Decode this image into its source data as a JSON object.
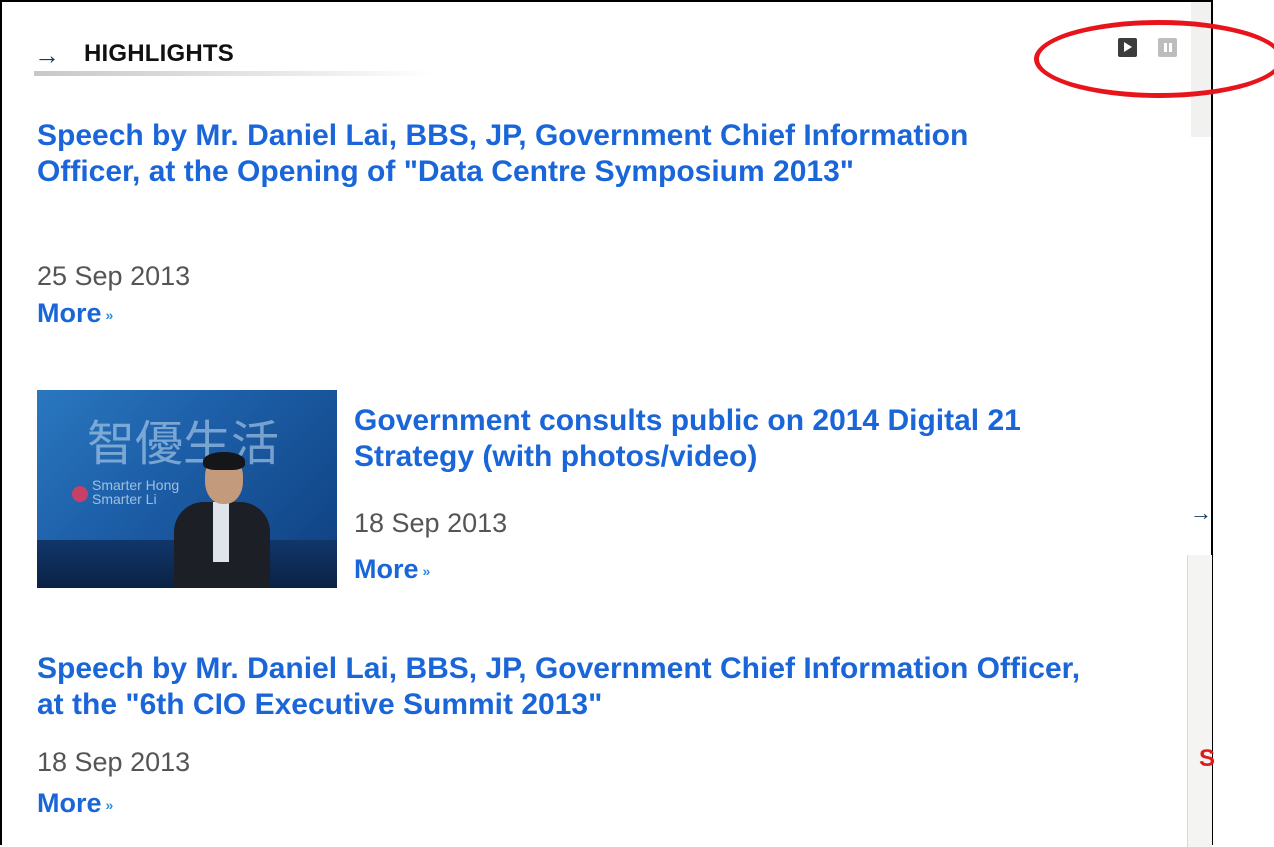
{
  "section": {
    "title": "HIGHLIGHTS",
    "arrow_icon": "right-arrow-icon"
  },
  "controls": {
    "play_icon": "play-icon",
    "pause_icon": "pause-icon"
  },
  "items": [
    {
      "headline": "Speech by Mr. Daniel Lai, BBS, JP, Government Chief Information Officer, at the Opening of \"Data Centre Symposium 2013\"",
      "date": "25 Sep 2013",
      "more": "More"
    },
    {
      "headline": "Government consults public on 2014 Digital 21 Strategy (with photos/video)",
      "date": "18 Sep 2013",
      "more": "More",
      "thumbnail": {
        "chinese_text": "智優生活",
        "english_lines": [
          "Smarter Hong",
          "Smarter Li"
        ]
      }
    },
    {
      "headline": "Speech by Mr. Daniel Lai, BBS, JP, Government Chief Information Officer, at the \"6th CIO Executive Summit 2013\"",
      "date": "18 Sep 2013",
      "more": "More"
    }
  ],
  "side_panel": {
    "letter": "S"
  },
  "colors": {
    "link": "#1a66d9",
    "annotation_ring": "#e8141c",
    "date": "#555555"
  }
}
